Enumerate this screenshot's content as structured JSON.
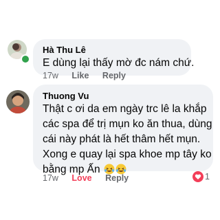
{
  "comments": [
    {
      "author": "Hà Thu Lê",
      "text": "E dùng lại thấy mờ đc nám chứ.",
      "time": "17w",
      "like": "Like",
      "reply": "Reply"
    },
    {
      "author": "Thuong Vu",
      "text_lines": [
        "Thật c ơi da em ngày trc lê la khắp",
        "các spa để trị mụn ko ăn thua, dùng",
        "cái này phát là hết thâm hết mụn.",
        "Xong e quay lại spa khoe mp tây ko",
        "bằng mp Ấn"
      ],
      "emojis": [
        "laughing-tears-emoji",
        "laughing-tears-emoji"
      ],
      "time": "17w",
      "reaction_label": "Love",
      "reply": "Reply",
      "reaction_count": "1",
      "reaction_icon": "heart-icon"
    }
  ],
  "colors": {
    "bubble": "#f0f2f5",
    "love": "#f33e58",
    "meta": "#65676b",
    "online": "#31a24c"
  }
}
